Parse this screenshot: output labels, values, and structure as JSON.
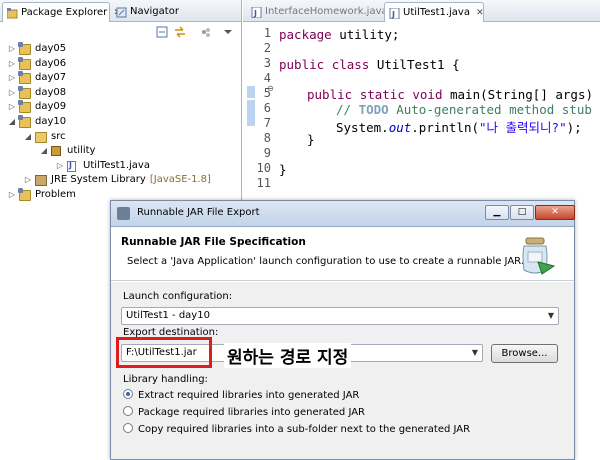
{
  "package_explorer": {
    "tab_label": "Package Explorer",
    "tab_close": "✕",
    "navigator_label": "Navigator",
    "tree": [
      {
        "label": "day05",
        "level": 0,
        "twisty": "▷",
        "icon": "project-folder-icon"
      },
      {
        "label": "day06",
        "level": 0,
        "twisty": "▷",
        "icon": "project-folder-icon"
      },
      {
        "label": "day07",
        "level": 0,
        "twisty": "▷",
        "icon": "project-folder-icon"
      },
      {
        "label": "day08",
        "level": 0,
        "twisty": "▷",
        "icon": "project-folder-icon"
      },
      {
        "label": "day09",
        "level": 0,
        "twisty": "▷",
        "icon": "project-folder-icon"
      },
      {
        "label": "day10",
        "level": 0,
        "twisty": "◢",
        "icon": "project-folder-icon"
      },
      {
        "label": "src",
        "level": 1,
        "twisty": "◢",
        "icon": "source-folder-icon"
      },
      {
        "label": "utility",
        "level": 2,
        "twisty": "◢",
        "icon": "package-icon"
      },
      {
        "label": "UtilTest1.java",
        "level": 3,
        "twisty": "▷",
        "icon": "java-file-icon"
      },
      {
        "label": "JRE System Library",
        "suffix": "[JavaSE-1.8]",
        "level": 1,
        "twisty": "▷",
        "icon": "library-icon"
      },
      {
        "label": "Problem",
        "level": 0,
        "twisty": "▷",
        "icon": "project-folder-icon"
      }
    ]
  },
  "editor": {
    "tabs": [
      {
        "label": "InterfaceHomework.java",
        "active": false
      },
      {
        "label": "UtilTest1.java",
        "active": true,
        "close": "✕"
      }
    ],
    "line_numbers": [
      "1",
      "2",
      "3",
      "4",
      "5",
      "6",
      "7",
      "8",
      "9",
      "10",
      "11"
    ],
    "code": {
      "l1_kw": "package",
      "l1_rest": " utility;",
      "l3_kw1": "public",
      "l3_kw2": "class",
      "l3_rest": " UtilTest1 {",
      "l5_kw1": "public",
      "l5_kw2": "static",
      "l5_kw3": "void",
      "l5_rest": " main(String[] args) {",
      "l6_comment": "// ",
      "l6_todo": "TODO",
      "l6_rest": " Auto-generated method stub",
      "l7_a": "System.",
      "l7_field": "out",
      "l7_b": ".println(",
      "l7_str": "\"나 출력되니?\"",
      "l7_c": ");",
      "l8": "}",
      "l10": "}"
    }
  },
  "dialog": {
    "title": "Runnable JAR File Export",
    "minimize": "▁",
    "maximize": "□",
    "close": "✕",
    "header_title": "Runnable JAR File Specification",
    "header_desc": "Select a 'Java Application' launch configuration to use to create a runnable JAR.",
    "launch_label": "Launch configuration:",
    "launch_value": "UtilTest1 - day10",
    "export_label": "Export destination:",
    "export_value": "F:\\UtilTest1.jar",
    "browse": "Browse...",
    "annotation": "원하는 경로 지정",
    "library_label": "Library handling:",
    "options": [
      {
        "label": "Extract required libraries into generated JAR",
        "selected": true
      },
      {
        "label": "Package required libraries into generated JAR",
        "selected": false
      },
      {
        "label": "Copy required libraries into a sub-folder next to the generated JAR",
        "selected": false
      }
    ]
  },
  "colors": {
    "highlight": "#e01b1b",
    "keyword": "#7f0055",
    "comment": "#3f7f5f",
    "string": "#2a00ff"
  }
}
